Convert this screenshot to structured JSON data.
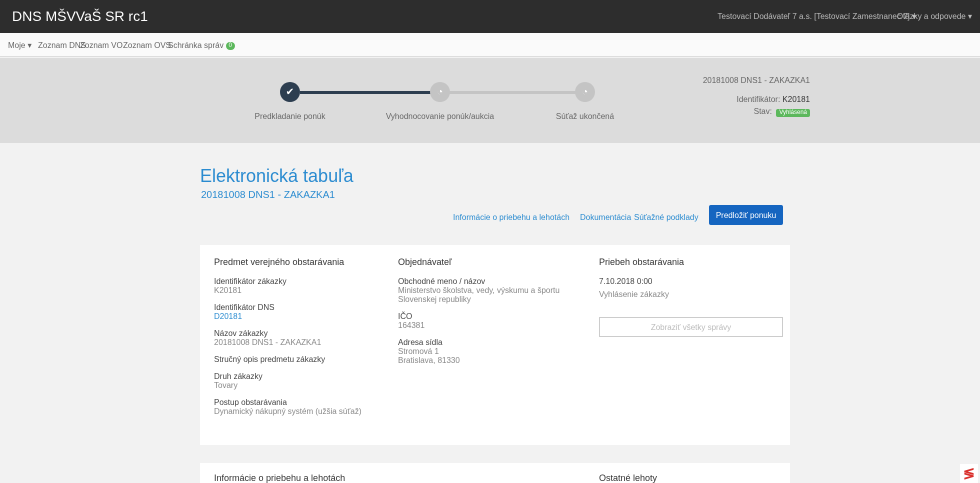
{
  "app": {
    "title": "DNS MŠVVaŠ SR rc1"
  },
  "header": {
    "user": "Testovací Dodávateľ 7 a.s. [Testovací Zamestnanec 7]",
    "help": "Otázky a odpovede"
  },
  "nav": {
    "items": [
      {
        "label": "Moje ▾"
      },
      {
        "label": "Zoznam DNS"
      },
      {
        "label": "Zoznam VO"
      },
      {
        "label": "Zoznam OVS"
      },
      {
        "label": "Schránka správ"
      }
    ],
    "inbox_count": "0"
  },
  "progress": {
    "steps": [
      {
        "label": "Predkladanie ponúk",
        "status": "done"
      },
      {
        "label": "Vyhodnocovanie ponúk/aukcia",
        "status": "pending"
      },
      {
        "label": "Súťaž ukončená",
        "status": "pending"
      }
    ],
    "completed_steps": 1,
    "total_steps": 3,
    "colors": {
      "done": "#2d3e50",
      "pending": "#c4c4c4"
    }
  },
  "info": {
    "name": "20181008 DNS1 - ZAKAZKA1",
    "id_label": "Identifikátor:",
    "id_value": "K20181",
    "stav_label": "Stav:",
    "stav_value": "Vyhlásená"
  },
  "page": {
    "title": "Elektronická tabuľa",
    "subtitle": "20181008 DNS1 - ZAKAZKA1"
  },
  "tabs": {
    "info": "Informácie o priebehu a lehotách",
    "docs": "Dokumentácia",
    "sutazne": "Súťažné podklady",
    "submit": "Predložiť ponuku"
  },
  "predmet": {
    "title": "Predmet verejného obstarávania",
    "fields": [
      {
        "label": "Identifikátor zákazky",
        "value": "K20181"
      },
      {
        "label": "Identifikátor DNS",
        "value": "D20181"
      },
      {
        "label": "Názov zákazky",
        "value": "20181008 DNS1 - ZAKAZKA1"
      },
      {
        "label": "Stručný opis predmetu zákazky",
        "value": ""
      },
      {
        "label": "Druh zákazky",
        "value": "Tovary"
      },
      {
        "label": "Postup obstarávania",
        "value": "Dynamický nákupný systém (užšia súťaž)"
      }
    ]
  },
  "objednavatel": {
    "title": "Objednávateľ",
    "fields": [
      {
        "label": "Obchodné meno / názov",
        "value": "Ministerstvo školstva, vedy, výskumu a športu Slovenskej republiky"
      },
      {
        "label": "IČO",
        "value": "164381"
      },
      {
        "label": "Adresa sídla",
        "value": "Stromová 1\nBratislava, 81330"
      }
    ]
  },
  "priebeh": {
    "title": "Priebeh obstarávania",
    "date": "7.10.2018 0:00",
    "event": "Vyhlásenie zákazky",
    "button": "Zobraziť všetky správy"
  },
  "bottom": {
    "left_title": "Informácie o priebehu a lehotách",
    "right_title": "Ostatné lehoty"
  },
  "colors": {
    "accent": "#2a8bd0",
    "primary": "#1565c0",
    "success": "#5cb85c",
    "topbar": "#2d2d2d"
  }
}
